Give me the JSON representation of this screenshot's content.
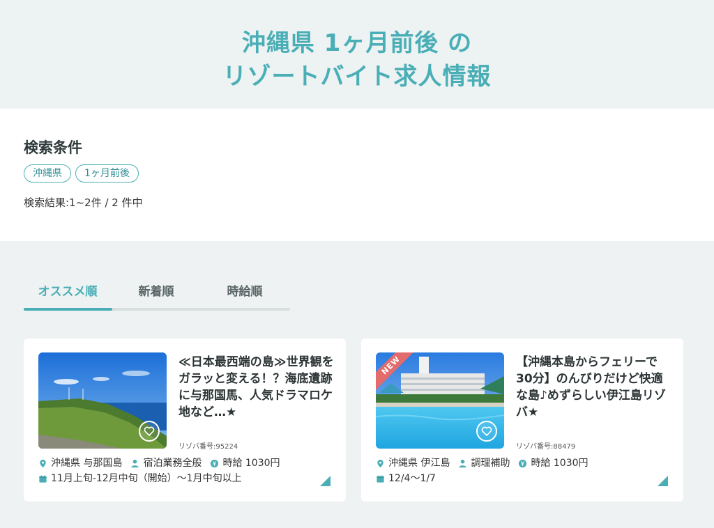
{
  "hero": {
    "title_line1": "沖縄県 1ヶ月前後 の",
    "title_line2": "リゾートバイト求人情報"
  },
  "search": {
    "label": "検索条件",
    "chips": [
      "沖縄県",
      "1ヶ月前後"
    ],
    "result_text": "検索結果:1~2件 / 2 件中"
  },
  "tabs": [
    {
      "label": "オススメ順",
      "active": true
    },
    {
      "label": "新着順",
      "active": false
    },
    {
      "label": "時給順",
      "active": false
    }
  ],
  "listings": [
    {
      "title": "≪日本最西端の島≫世界観をガラッと変える！？海底遺跡に与那国馬、人気ドラマロケ地など…★",
      "number": "リゾバ番号:95224",
      "location": "沖縄県 与那国島",
      "job": "宿泊業務全般",
      "wage": "時給 1030円",
      "period": "11月上旬-12月中旬（開始）〜1月中旬以上",
      "badge": "",
      "favorite_icon": "heart-icon"
    },
    {
      "title": "【沖縄本島からフェリーで30分】のんびりだけど快適な島♪めずらしい伊江島リゾバ★",
      "number": "リゾバ番号:88479",
      "location": "沖縄県 伊江島",
      "job": "調理補助",
      "wage": "時給 1030円",
      "period": "12/4〜1/7",
      "badge": "NEW",
      "favorite_icon": "heart-icon"
    }
  ],
  "colors": {
    "accent": "#49aeb5",
    "new_badge": "#e36b6b",
    "hero_bg": "#edf2f3"
  }
}
